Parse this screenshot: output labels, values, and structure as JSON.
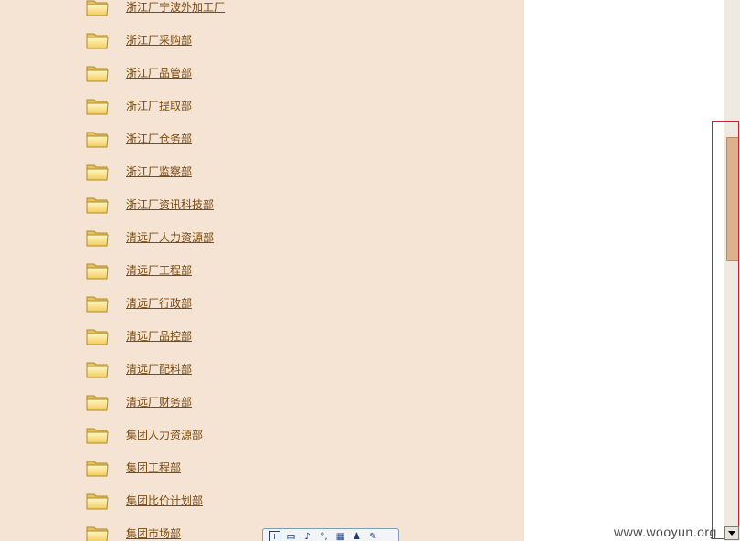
{
  "folders": [
    {
      "label": "浙江厂宁波外加工厂"
    },
    {
      "label": "浙江厂采购部"
    },
    {
      "label": "浙江厂品管部"
    },
    {
      "label": "浙江厂提取部"
    },
    {
      "label": "浙江厂仓务部"
    },
    {
      "label": "浙江厂监察部"
    },
    {
      "label": "浙江厂资讯科技部"
    },
    {
      "label": "清远厂人力资源部"
    },
    {
      "label": "清远厂工程部"
    },
    {
      "label": "清远厂行政部"
    },
    {
      "label": "清远厂品控部"
    },
    {
      "label": "清远厂配料部"
    },
    {
      "label": "清远厂财务部"
    },
    {
      "label": "集团人力资源部"
    },
    {
      "label": "集团工程部"
    },
    {
      "label": "集团比价计划部"
    },
    {
      "label": "集团市场部"
    }
  ],
  "folder_icon": "folder-icon",
  "ime_toolbar": {
    "items": [
      {
        "icon": "ime-mode-icon",
        "text": "I"
      },
      {
        "icon": "chinese-input-icon",
        "text": "中"
      },
      {
        "icon": "half-width-icon",
        "text": "♪"
      },
      {
        "icon": "punctuation-icon",
        "text": "°,"
      },
      {
        "icon": "soft-keyboard-icon",
        "text": "▦"
      },
      {
        "icon": "user-icon",
        "text": "♟"
      },
      {
        "icon": "wrench-icon",
        "text": "✎"
      }
    ]
  },
  "watermark": "www.wooyun.org",
  "colors": {
    "left_background": "#f5e4d3",
    "link": "#7a4a10",
    "highlight_border": "#c3232a",
    "scroll_thumb": "#dcb28c"
  }
}
